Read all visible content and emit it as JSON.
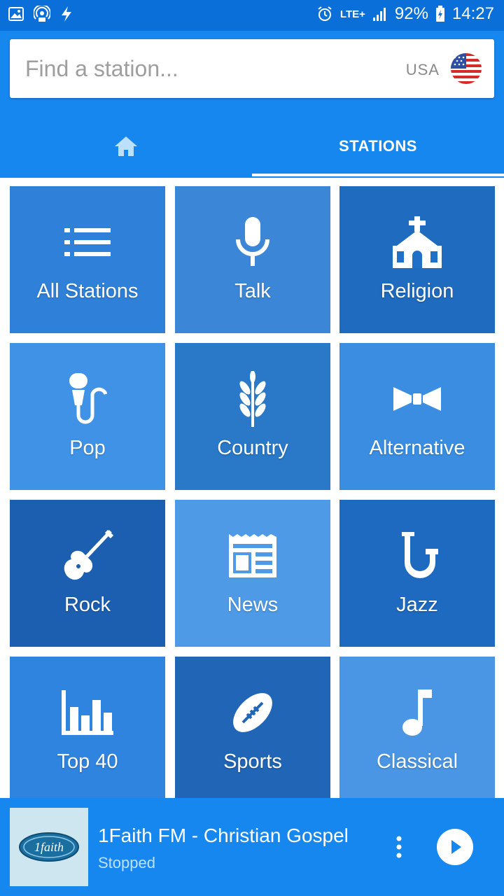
{
  "status_bar": {
    "network": "LTE+",
    "battery": "92%",
    "time": "14:27",
    "icons": [
      "gallery-icon",
      "hotspot-icon",
      "flash-icon",
      "alarm-icon",
      "signal-icon",
      "battery-icon"
    ]
  },
  "search": {
    "placeholder": "Find a station...",
    "country": "USA"
  },
  "tabs": {
    "home_icon": "home-icon",
    "stations_label": "STATIONS"
  },
  "categories": [
    {
      "label": "All Stations",
      "icon": "list-icon",
      "color": "#2f80d9"
    },
    {
      "label": "Talk",
      "icon": "microphone-icon",
      "color": "#3b86d6"
    },
    {
      "label": "Religion",
      "icon": "church-icon",
      "color": "#1f6bbf"
    },
    {
      "label": "Pop",
      "icon": "singer-mic-icon",
      "color": "#3f92e6"
    },
    {
      "label": "Country",
      "icon": "wheat-icon",
      "color": "#2a78c8"
    },
    {
      "label": "Alternative",
      "icon": "bowtie-icon",
      "color": "#3a8de0"
    },
    {
      "label": "Rock",
      "icon": "electric-guitar-icon",
      "color": "#1c5fb0"
    },
    {
      "label": "News",
      "icon": "newspaper-icon",
      "color": "#4f9ae6"
    },
    {
      "label": "Jazz",
      "icon": "saxophone-icon",
      "color": "#1e6ac0"
    },
    {
      "label": "Top 40",
      "icon": "bar-chart-icon",
      "color": "#2f84e0"
    },
    {
      "label": "Sports",
      "icon": "football-icon",
      "color": "#2065b6"
    },
    {
      "label": "Classical",
      "icon": "music-note-icon",
      "color": "#4a96e4"
    }
  ],
  "player": {
    "logo_text": "1faith",
    "title": "1Faith FM - Christian Gospel",
    "status": "Stopped"
  },
  "colors": {
    "status_bar": "#0a6fd8",
    "primary": "#1787f0"
  }
}
